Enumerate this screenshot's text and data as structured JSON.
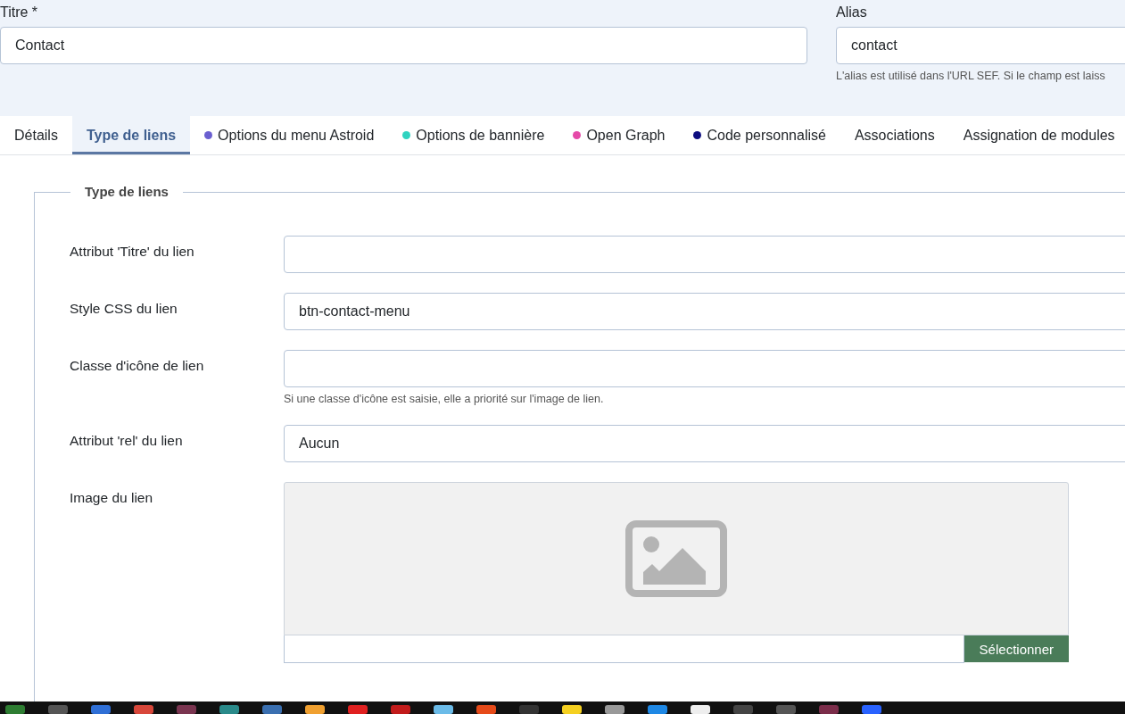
{
  "title_field": {
    "label": "Titre *",
    "value": "Contact"
  },
  "alias_field": {
    "label": "Alias",
    "value": "contact",
    "help": "L'alias est utilisé dans l'URL SEF. Si le champ est laiss"
  },
  "tabs": [
    {
      "label": "Détails",
      "selected": false
    },
    {
      "label": "Type de liens",
      "selected": true
    },
    {
      "label": "Options du menu Astroid",
      "selected": false,
      "color": "#6a5fd0"
    },
    {
      "label": "Options de bannière",
      "selected": false,
      "color": "#2fd3c0"
    },
    {
      "label": "Open Graph",
      "selected": false,
      "color": "#e54aa8"
    },
    {
      "label": "Code personnalisé",
      "selected": false,
      "color": "#0d0d80"
    },
    {
      "label": "Associations",
      "selected": false
    },
    {
      "label": "Assignation de modules",
      "selected": false
    }
  ],
  "fieldset": {
    "legend": "Type de liens",
    "rows": [
      {
        "kind": "text",
        "label": "Attribut 'Titre' du lien"
      },
      {
        "kind": "text",
        "label": "Style CSS du lien",
        "value": "btn-contact-menu"
      },
      {
        "kind": "text",
        "label": "Classe d'icône de lien",
        "help": "Si une classe d'icône est saisie, elle a priorité sur l'image de lien."
      },
      {
        "kind": "select",
        "label": "Attribut 'rel' du lien",
        "value": "Aucun"
      },
      {
        "kind": "image",
        "label": "Image du lien",
        "button": "Sélectionner"
      }
    ]
  }
}
